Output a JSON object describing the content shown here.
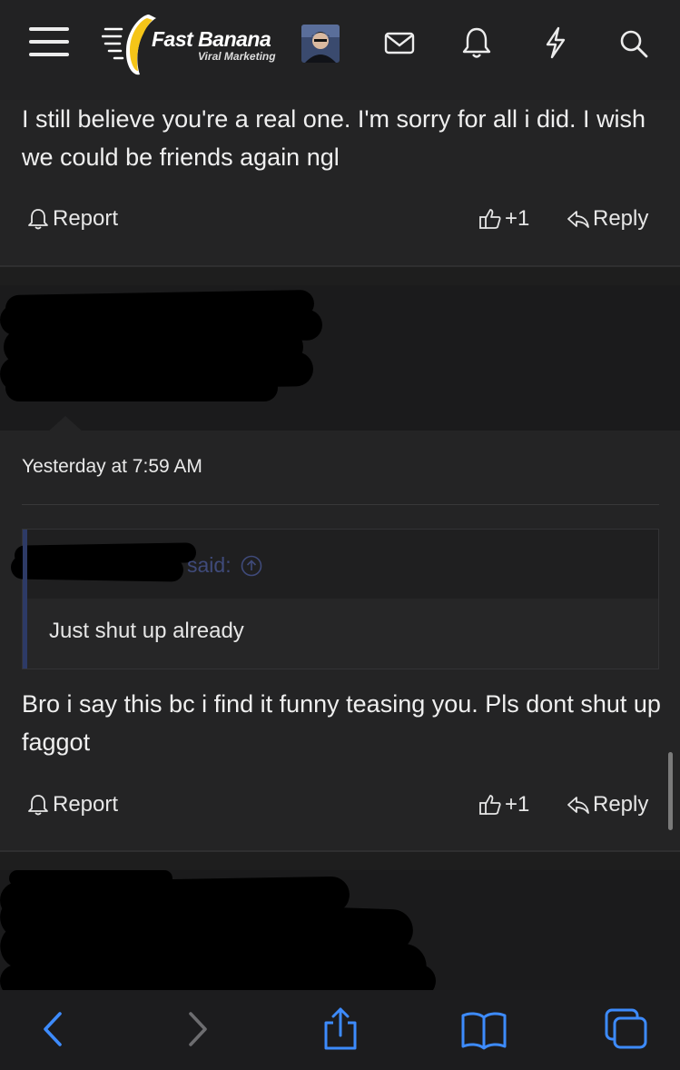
{
  "header": {
    "logo_name": "Fast Banana",
    "logo_tagline": "Viral Marketing",
    "icons": [
      "menu-icon",
      "mail-icon",
      "bell-icon",
      "bolt-icon",
      "search-icon"
    ]
  },
  "posts": [
    {
      "body": "I still believe you're a real one. I'm sorry for all i did. I wish we could be friends again ngl",
      "report_label": "Report",
      "reaction_count": "+1",
      "reply_label": "Reply"
    },
    {
      "timestamp": "Yesterday at 7:59 AM",
      "quote": {
        "said_label": "said:",
        "text": "Just shut up already"
      },
      "body": "Bro i say this bc i find it funny teasing you. Pls dont shut up faggot",
      "report_label": "Report",
      "reaction_count": "+1",
      "reply_label": "Reply"
    }
  ],
  "browser_toolbar": {
    "icons": [
      "back-icon",
      "forward-icon",
      "share-icon",
      "bookmarks-icon",
      "tabs-icon"
    ],
    "accent": "#3d8bfd"
  },
  "colors": {
    "background": "#1e1e1e",
    "post_background": "#242425",
    "quote_accent": "#2d3a66",
    "text": "#ececec"
  }
}
